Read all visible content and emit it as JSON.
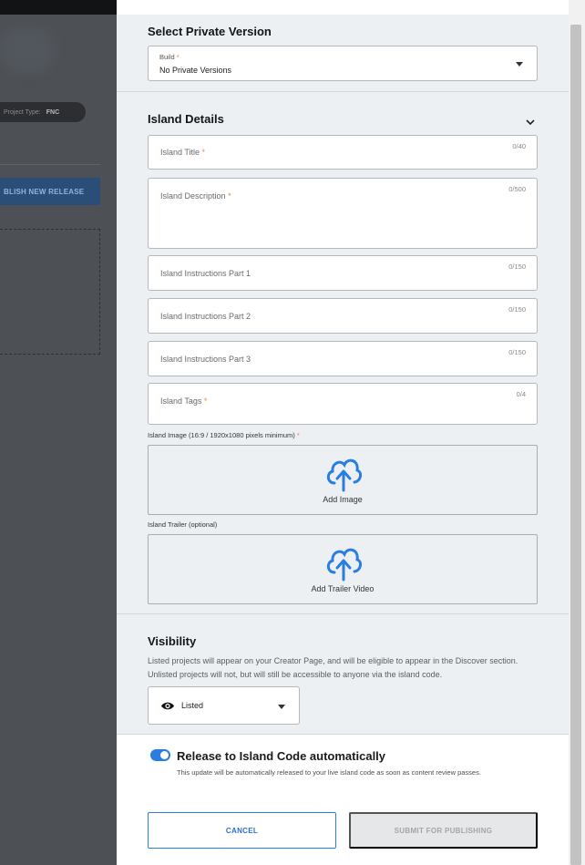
{
  "background": {
    "project_type_label": "Project Type:",
    "project_type_value": "FNC",
    "publish_button": "BLISH NEW RELEASE"
  },
  "private_version": {
    "title": "Select Private Version",
    "build_label": "Build",
    "build_required": "*",
    "build_value": "No Private Versions"
  },
  "island_details": {
    "title": "Island Details",
    "fields": [
      {
        "label": "Island Title",
        "required": "*",
        "count": "0/40"
      },
      {
        "label": "Island Description",
        "required": "*",
        "count": "0/500"
      },
      {
        "label": "Island Instructions Part 1",
        "required": "",
        "count": "0/150"
      },
      {
        "label": "Island Instructions Part 2",
        "required": "",
        "count": "0/150"
      },
      {
        "label": "Island Instructions Part 3",
        "required": "",
        "count": "0/150"
      },
      {
        "label": "Island Tags",
        "required": "*",
        "count": "0/4"
      }
    ],
    "image_label": "Island Image (16:9 / 1920x1080 pixels minimum)",
    "image_required": "*",
    "image_button": "Add Image",
    "trailer_label": "Island Trailer (optional)",
    "trailer_button": "Add Trailer Video"
  },
  "visibility": {
    "title": "Visibility",
    "description": "Listed projects will appear on your Creator Page, and will be eligible to appear in the Discover section. Unlisted projects will not, but will still be accessible to anyone via the island code.",
    "selected": "Listed"
  },
  "release": {
    "toggle_label": "Release to Island Code automatically",
    "toggle_description": "This update will be automatically released to your live island code as soon as content review passes.",
    "toggle_on": true
  },
  "buttons": {
    "cancel": "CANCEL",
    "submit": "SUBMIT FOR PUBLISHING"
  },
  "colors": {
    "accent": "#2a7de1",
    "required": "#e8884a",
    "panel_bg": "#edf0f3"
  }
}
